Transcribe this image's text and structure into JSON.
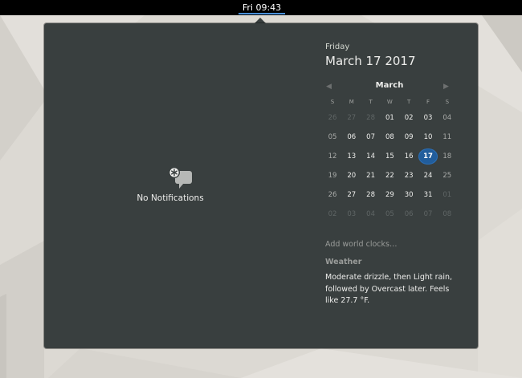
{
  "topbar": {
    "clock": "Fri 09:43"
  },
  "notifications": {
    "empty_label": "No Notifications",
    "icon": "no-notifications-icon"
  },
  "calendar": {
    "weekday": "Friday",
    "full_date": "March 17 2017",
    "month": "March",
    "day_headers": [
      "S",
      "M",
      "T",
      "W",
      "T",
      "F",
      "S"
    ],
    "weeks": [
      [
        "26",
        "27",
        "28",
        "01",
        "02",
        "03",
        "04"
      ],
      [
        "05",
        "06",
        "07",
        "08",
        "09",
        "10",
        "11"
      ],
      [
        "12",
        "13",
        "14",
        "15",
        "16",
        "17",
        "18"
      ],
      [
        "19",
        "20",
        "21",
        "22",
        "23",
        "24",
        "25"
      ],
      [
        "26",
        "27",
        "28",
        "29",
        "30",
        "31",
        "01"
      ],
      [
        "02",
        "03",
        "04",
        "05",
        "06",
        "07",
        "08"
      ]
    ],
    "today": "17"
  },
  "world_clocks": {
    "label": "Add world clocks…"
  },
  "weather": {
    "title": "Weather",
    "description": "Moderate drizzle, then Light rain, followed by Overcast later. Feels like 27.7 °F."
  },
  "colors": {
    "popover_bg": "#393f3f",
    "today_highlight": "#215d9c",
    "topbar_bg": "#000000"
  }
}
